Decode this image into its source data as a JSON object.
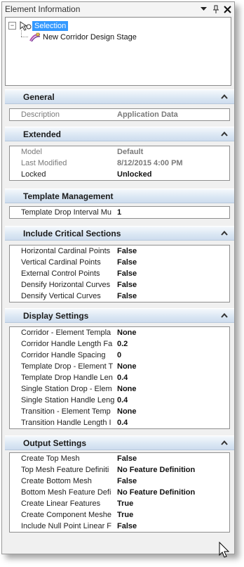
{
  "window": {
    "title": "Element Information"
  },
  "tree": {
    "root_label": "Selection",
    "child_label": "New Corridor Design Stage"
  },
  "sections": {
    "general": {
      "title": "General",
      "rows": [
        {
          "label": "Description",
          "value": "Application Data"
        }
      ]
    },
    "extended": {
      "title": "Extended",
      "rows": [
        {
          "label": "Model",
          "value": "Default"
        },
        {
          "label": "Last Modified",
          "value": "8/12/2015 4:00 PM"
        },
        {
          "label": "Locked",
          "value": "Unlocked"
        }
      ]
    },
    "template_management": {
      "title": "Template Management",
      "rows": [
        {
          "label": "Template Drop Interval Mu",
          "value": "1"
        }
      ]
    },
    "critical_sections": {
      "title": "Include Critical Sections",
      "rows": [
        {
          "label": "Horizontal Cardinal Points",
          "value": "False"
        },
        {
          "label": "Vertical Cardinal Points",
          "value": "False"
        },
        {
          "label": "External Control Points",
          "value": "False"
        },
        {
          "label": "Densify Horizontal Curves",
          "value": "False"
        },
        {
          "label": "Densify Vertical Curves",
          "value": "False"
        }
      ]
    },
    "display_settings": {
      "title": "Display Settings",
      "rows": [
        {
          "label": "Corridor - Element Templa",
          "value": "None"
        },
        {
          "label": "Corridor Handle Length Fa",
          "value": "0.2"
        },
        {
          "label": "Corridor Handle Spacing",
          "value": "0"
        },
        {
          "label": "Template Drop - Element T",
          "value": "None"
        },
        {
          "label": "Template Drop Handle Len",
          "value": "0.4"
        },
        {
          "label": "Single Station Drop - Elem",
          "value": "None"
        },
        {
          "label": "Single Station Handle Leng",
          "value": "0.4"
        },
        {
          "label": "Transition - Element Temp",
          "value": "None"
        },
        {
          "label": "Transition Handle Length I",
          "value": "0.4"
        }
      ]
    },
    "output_settings": {
      "title": "Output Settings",
      "rows": [
        {
          "label": "Create Top Mesh",
          "value": "False"
        },
        {
          "label": "Top Mesh Feature Definiti",
          "value": "No Feature Definition"
        },
        {
          "label": "Create Bottom Mesh",
          "value": "False"
        },
        {
          "label": "Bottom Mesh Feature Defi",
          "value": "No Feature Definition"
        },
        {
          "label": "Create Linear Features",
          "value": "True"
        },
        {
          "label": "Create Component Meshe",
          "value": "True"
        },
        {
          "label": "Include Null Point Linear F",
          "value": "False"
        }
      ]
    }
  },
  "icons": {
    "dropdown": "dropdown-arrow-icon",
    "pin": "pin-icon",
    "close": "close-icon",
    "collapse": "chevron-up-icon",
    "selection": "selection-set-icon",
    "corridor": "corridor-icon",
    "cursor": "mouse-pointer-icon"
  },
  "colors": {
    "selection_highlight": "#3399ff",
    "section_header": "#dce8f4"
  }
}
